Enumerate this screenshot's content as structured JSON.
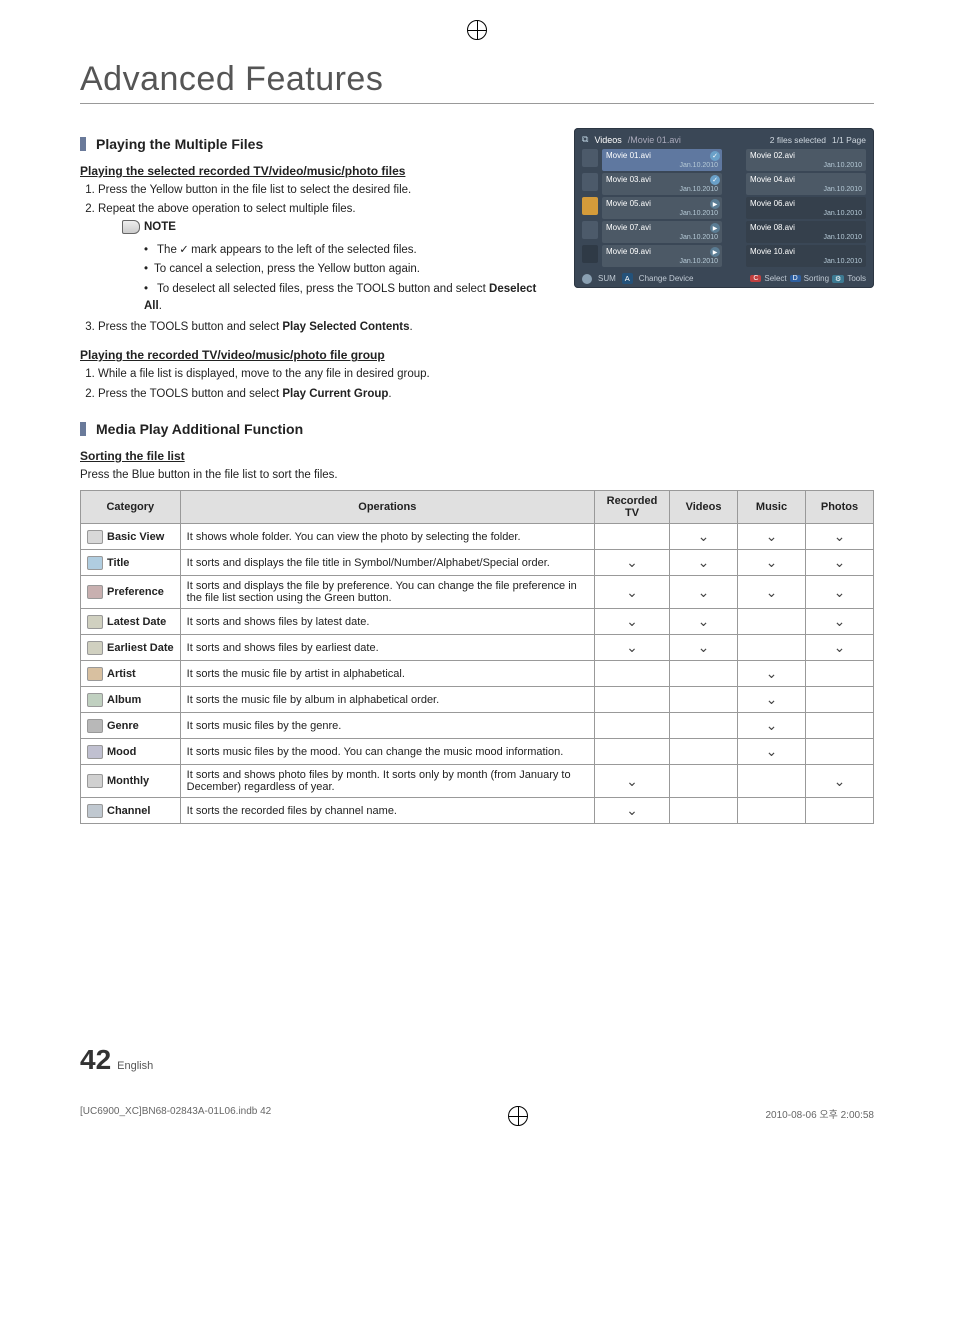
{
  "page_title": "Advanced Features",
  "section1": {
    "heading": "Playing the Multiple Files",
    "sub1": "Playing the selected recorded TV/video/music/photo files",
    "step1": "Press the Yellow button in the file list to select the desired file.",
    "step2": "Repeat the above operation to select multiple files.",
    "note_label": "NOTE",
    "note_b1_a": "The ",
    "note_b1_check": "✓",
    "note_b1_b": " mark appears to the left of the selected files.",
    "note_b2": "To cancel a selection, press the Yellow button again.",
    "note_b3_a": "To deselect all selected files, press the ",
    "note_b3_tools": "TOOLS",
    "note_b3_b": " button and select ",
    "note_b3_bold": "Deselect All",
    "note_b3_c": ".",
    "step3_a": "Press the ",
    "step3_tools": "TOOLS",
    "step3_b": " button and select ",
    "step3_bold": "Play Selected Contents",
    "step3_c": ".",
    "sub2": "Playing the recorded TV/video/music/photo file group",
    "grp_step1": "While a file list is displayed, move to the any file in desired group.",
    "grp_step2_a": "Press the ",
    "grp_step2_tools": "TOOLS",
    "grp_step2_b": " button and select ",
    "grp_step2_bold": "Play Current Group",
    "grp_step2_c": "."
  },
  "section2": {
    "heading": "Media Play Additional Function",
    "sub": "Sorting the file list",
    "intro": "Press the Blue button in the file list to sort the files.",
    "th": {
      "cat": "Category",
      "ops": "Operations",
      "rec": "Recorded TV",
      "vid": "Videos",
      "mus": "Music",
      "pho": "Photos"
    },
    "rows": [
      {
        "name": "Basic View",
        "icon": "folder",
        "op": "It shows whole folder. You can view the photo by selecting the folder.",
        "rec": "",
        "vid": "✓",
        "mus": "✓",
        "pho": "✓"
      },
      {
        "name": "Title",
        "icon": "title",
        "op": "It sorts and displays the file title in Symbol/Number/Alphabet/Special order.",
        "rec": "✓",
        "vid": "✓",
        "mus": "✓",
        "pho": "✓"
      },
      {
        "name": "Preference",
        "icon": "pref",
        "op": "It sorts and displays the file by preference. You can change the file preference in the file list section using the Green button.",
        "rec": "✓",
        "vid": "✓",
        "mus": "✓",
        "pho": "✓"
      },
      {
        "name": "Latest Date",
        "icon": "date",
        "op": "It sorts and shows files by latest date.",
        "rec": "✓",
        "vid": "✓",
        "mus": "",
        "pho": "✓"
      },
      {
        "name": "Earliest Date",
        "icon": "date",
        "op": "It sorts and shows files by earliest date.",
        "rec": "✓",
        "vid": "✓",
        "mus": "",
        "pho": "✓"
      },
      {
        "name": "Artist",
        "icon": "artist",
        "op": "It sorts the music file by artist in alphabetical.",
        "rec": "",
        "vid": "",
        "mus": "✓",
        "pho": ""
      },
      {
        "name": "Album",
        "icon": "album",
        "op": "It sorts the music file by album in alphabetical order.",
        "rec": "",
        "vid": "",
        "mus": "✓",
        "pho": ""
      },
      {
        "name": "Genre",
        "icon": "genre",
        "op": "It sorts music files by the genre.",
        "rec": "",
        "vid": "",
        "mus": "✓",
        "pho": ""
      },
      {
        "name": "Mood",
        "icon": "mood",
        "op": "It sorts music files by the mood. You can change the music mood information.",
        "rec": "",
        "vid": "",
        "mus": "✓",
        "pho": ""
      },
      {
        "name": "Monthly",
        "icon": "month",
        "op": "It sorts and shows photo files by month. It sorts only by month (from January to December) regardless of year.",
        "rec": "✓",
        "vid": "",
        "mus": "",
        "pho": "✓"
      },
      {
        "name": "Channel",
        "icon": "channel",
        "op": "It sorts the recorded files by channel name.",
        "rec": "✓",
        "vid": "",
        "mus": "",
        "pho": ""
      }
    ]
  },
  "screenshot": {
    "header": {
      "cat": "Videos",
      "path": "/Movie 01.avi",
      "selcount": "2 files selected",
      "page": "1/1 Page"
    },
    "items": [
      {
        "n": "Movie 01.avi",
        "d": "Jan.10.2010",
        "sel": true,
        "chk": true
      },
      {
        "n": "Movie 02.avi",
        "d": "Jan.10.2010"
      },
      {
        "n": "Movie 03.avi",
        "d": "Jan.10.2010",
        "chk": true
      },
      {
        "n": "Movie 04.avi",
        "d": "Jan.10.2010"
      },
      {
        "n": "Movie 05.avi",
        "d": "Jan.10.2010",
        "play": true
      },
      {
        "n": "Movie 06.avi",
        "d": "Jan.10.2010",
        "dim": true
      },
      {
        "n": "Movie 07.avi",
        "d": "Jan.10.2010",
        "play": true
      },
      {
        "n": "Movie 08.avi",
        "d": "Jan.10.2010",
        "dim": true
      },
      {
        "n": "Movie 09.avi",
        "d": "Jan.10.2010",
        "play": true
      },
      {
        "n": "Movie 10.avi",
        "d": "Jan.10.2010",
        "dim": true
      }
    ],
    "footer": {
      "sum": "SUM",
      "chg": "Change Device",
      "sel": "Select",
      "sort": "Sorting",
      "tools": "Tools",
      "a": "A",
      "c": "C",
      "d": "D"
    }
  },
  "footer": {
    "page": "42",
    "lang": "English"
  },
  "bottom": {
    "left": "[UC6900_XC]BN68-02843A-01L06.indb   42",
    "right": "2010-08-06   오후 2:00:58"
  }
}
